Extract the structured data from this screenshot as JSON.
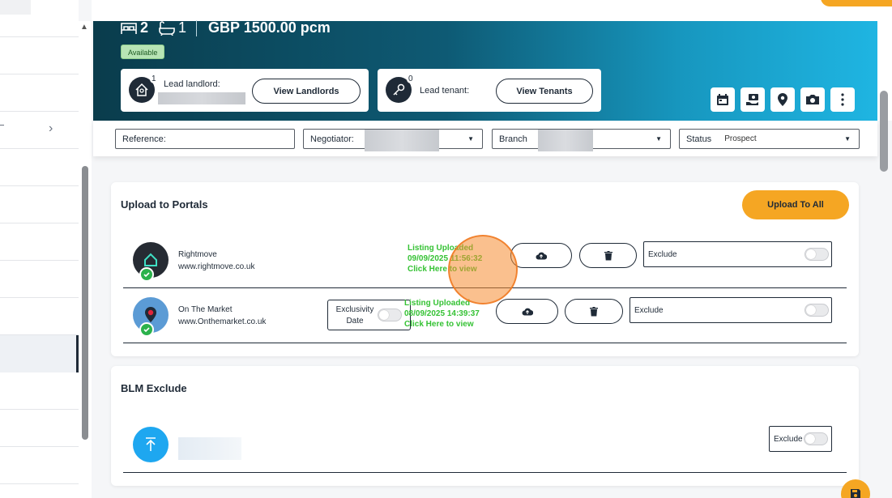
{
  "property": {
    "bedrooms": "2",
    "bathrooms": "1",
    "price": "GBP 1500.00 pcm",
    "status_badge": "Available"
  },
  "landlord": {
    "label": "Lead landlord:",
    "count": "1",
    "button": "View Landlords"
  },
  "tenant": {
    "label": "Lead tenant:",
    "count": "0",
    "button": "View Tenants"
  },
  "hero_actions": [
    "calendar-icon",
    "money-hand-icon",
    "location-pin-icon",
    "camera-icon",
    "more-vertical-icon"
  ],
  "filters": {
    "reference_label": "Reference:",
    "negotiator_label": "Negotiator:",
    "branch_label": "Branch",
    "status_label": "Status",
    "status_value": "Prospect"
  },
  "portals": {
    "title": "Upload to Portals",
    "upload_all": "Upload To All",
    "items": [
      {
        "name": "Rightmove",
        "url": "www.rightmove.co.uk",
        "status_line1": "Listing Uploaded",
        "status_line2": "09/09/2025 11:56:32",
        "status_line3": "Click Here to view",
        "exclude_label": "Exclude"
      },
      {
        "name": "On The Market",
        "url": "www.Onthemarket.co.uk",
        "exclusivity_label": "Exclusivity Date",
        "status_line1": "Listing Uploaded",
        "status_line2": "08/09/2025 14:39:37",
        "status_line3": "Click Here to view",
        "exclude_label": "Exclude"
      }
    ]
  },
  "blm": {
    "title": "BLM Exclude",
    "exclude_label": "Exclude"
  },
  "colors": {
    "accent": "#f5a623",
    "success": "#35c234",
    "dark": "#1f2a37"
  }
}
